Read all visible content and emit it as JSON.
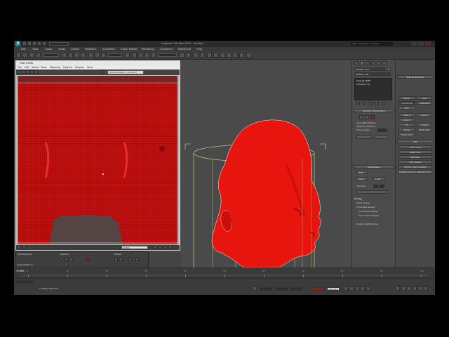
{
  "app": {
    "logo": "3",
    "title": "Autodesk 3ds Max 2015 - Untitled",
    "search_placeholder": "Type a keyword or phrase"
  },
  "menubar": [
    "Edit",
    "Tools",
    "Group",
    "Views",
    "Create",
    "Modifiers",
    "Animation",
    "Graph Editors",
    "Rendering",
    "Customize",
    "MAXScript",
    "Help"
  ],
  "uvw_editor": {
    "title": "Edit UVWs",
    "menu": [
      "File",
      "Edit",
      "Select",
      "Tools",
      "Mapping",
      "Options",
      "Display",
      "View"
    ],
    "checker_dropdown": "CheckerPattern ( Checker )",
    "bottom_dropdown": "All IDs"
  },
  "uv_options": {
    "group1": "Soft Selection",
    "group2": "Selection",
    "group3": "Rotate",
    "label_edges": "Edge Distance"
  },
  "modifier_panel": {
    "object_name": "Editable Poly",
    "modifier_list": "Modifier List",
    "stack": [
      "Unwrap UVW",
      "Editable Poly"
    ],
    "rollouts": {
      "selection": "Selection Parameters",
      "parameters": "Parameters",
      "display": "Display"
    },
    "checkboxes": [
      "Ignore Backfacing",
      "Select by Element",
      "Planar Angle"
    ],
    "params_buttons": [
      "Edit...",
      "Save...",
      "Load..."
    ],
    "channel_label": "Channel:",
    "channel_value": "1",
    "display_options": [
      "Show Seams",
      "Show Peel Seams",
      "Thin Seam Display",
      "Thick Seam Display"
    ],
    "prevent_label": "Prevent Reflattening"
  },
  "right_panel": {
    "header": "Map Parameters",
    "buttons": [
      "Planar",
      "Pelt",
      "Cylindrical",
      "Spherical",
      "Box",
      "Align X",
      "Align Y",
      "Align Z",
      "Fit",
      "Center",
      "Reset",
      "Best Align",
      "View Align"
    ],
    "peel_header": "Peel",
    "peel_buttons": [
      "Quick Peel",
      "Reset Peel",
      "Pelt Map",
      "Edit Seams",
      "Point to Point Seams",
      "Expand Polygon Selection to Seams"
    ]
  },
  "status": {
    "selected": "1 Object Selected",
    "frame": "0 / 100",
    "mode": "Selected"
  },
  "timeline_ticks": [
    "0",
    "10",
    "20",
    "30",
    "40",
    "50",
    "60",
    "70",
    "80",
    "90",
    "100"
  ]
}
